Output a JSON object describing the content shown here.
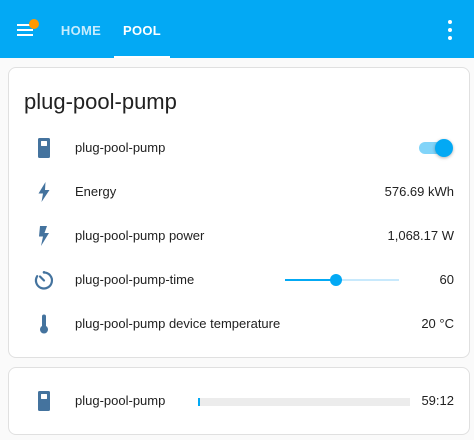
{
  "header": {
    "tabs": [
      {
        "label": "HOME"
      },
      {
        "label": "POOL"
      }
    ],
    "active_tab": "POOL",
    "accent_color": "#03a9f4",
    "notification_dot_color": "#ff9800"
  },
  "card": {
    "title": "plug-pool-pump",
    "rows": [
      {
        "name": "plug-pool-pump",
        "icon": "power-socket-icon",
        "control": "toggle",
        "state": "on"
      },
      {
        "name": "Energy",
        "icon": "flash-icon",
        "value": "576.69 kWh"
      },
      {
        "name": "plug-pool-pump power",
        "icon": "flash-icon",
        "value": "1,068.17 W"
      },
      {
        "name": "plug-pool-pump-time",
        "icon": "timer-icon",
        "control": "slider",
        "value": "60",
        "slider_fraction": 0.45
      },
      {
        "name": "plug-pool-pump device temperature",
        "icon": "thermometer-icon",
        "value": "20 °C"
      }
    ]
  },
  "timer_card": {
    "name": "plug-pool-pump",
    "icon": "power-socket-icon",
    "value": "59:12",
    "progress_fraction": 0.01
  }
}
